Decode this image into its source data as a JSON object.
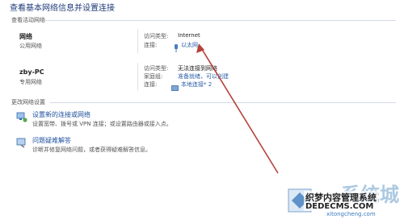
{
  "header": {
    "title": "查看基本网络信息并设置连接"
  },
  "active_networks": {
    "section_label": "查看活动网络",
    "networks": [
      {
        "name": "网络",
        "type": "公用网络",
        "access_label": "访问类型:",
        "access_value": "Internet",
        "conn_label": "连接:",
        "conn_value": "以太网"
      },
      {
        "name": "zby-PC",
        "type": "专用网络",
        "access_label": "访问类型:",
        "access_value": "无法连接到网络",
        "home_label": "家庭组:",
        "home_value": "准备就绪，可以创建",
        "conn_label": "连接:",
        "conn_value": "本地连接* 2"
      }
    ]
  },
  "change_settings": {
    "section_label": "更改网络设置",
    "tasks": [
      {
        "title": "设置新的连接或网络",
        "desc": "设置宽带、拨号或 VPN 连接；或设置路由器或接入点。",
        "icon": "network-setup-icon"
      },
      {
        "title": "问题疑难解答",
        "desc": "诊断并修复网络问题，或者获得疑难解答信息。",
        "icon": "troubleshoot-icon"
      }
    ]
  },
  "annotation": {
    "arrow_color": "#b5423a"
  },
  "watermarks": {
    "brand": "系统城",
    "cn": "织梦内容管理系统",
    "domain": "DEDECMS.COM",
    "site": "xitongcheng.com"
  }
}
